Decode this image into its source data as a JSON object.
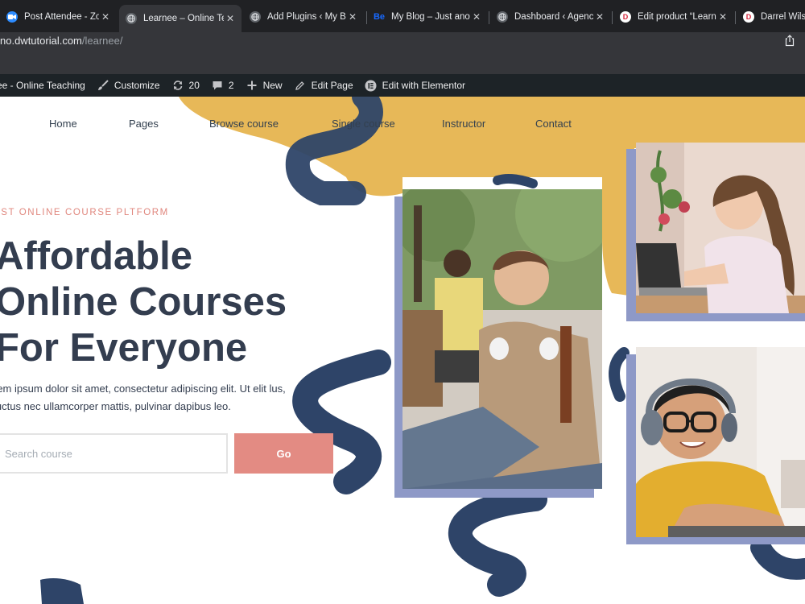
{
  "browser": {
    "tabs": [
      {
        "title": "Post Attendee - Zoom",
        "icon": "zoom-icon",
        "active": false
      },
      {
        "title": "Learnee – Online Teaching",
        "icon": "globe-icon",
        "active": true
      },
      {
        "title": "Add Plugins ‹ My Blog",
        "icon": "globe-icon",
        "active": false
      },
      {
        "title": "My Blog – Just another",
        "icon": "behance-icon",
        "active": false
      },
      {
        "title": "Dashboard ‹ Agency",
        "icon": "globe-icon",
        "active": false
      },
      {
        "title": "Edit product “Learnee”",
        "icon": "d-icon",
        "active": false
      },
      {
        "title": "Darrel Wilson",
        "icon": "d-icon",
        "active": false
      }
    ],
    "url_host": "no.dwtutorial.com",
    "url_path": "/learnee/"
  },
  "admin_bar": {
    "site_name": "ee - Online Teaching",
    "customize": "Customize",
    "updates": "20",
    "comments": "2",
    "new": "New",
    "edit_page": "Edit Page",
    "edit_elementor": "Edit with Elementor"
  },
  "site": {
    "nav": [
      "Home",
      "Pages",
      "Browse course",
      "Single course",
      "Instructor",
      "Contact"
    ],
    "eyebrow": "EST ONLINE COURSE PLTFORM",
    "headline": [
      "Affordable",
      "Online Courses",
      "For Everyone"
    ],
    "lede": "rem ipsum dolor sit amet, consectetur adipiscing elit. Ut elit lus, luctus nec ullamcorper mattis, pulvinar dapibus leo.",
    "search_placeholder": "Search course",
    "go_label": "Go"
  },
  "colors": {
    "accent": "#e38b83",
    "navy": "#333d4f",
    "mustard": "#e7b858",
    "frame": "#8e99c7"
  }
}
